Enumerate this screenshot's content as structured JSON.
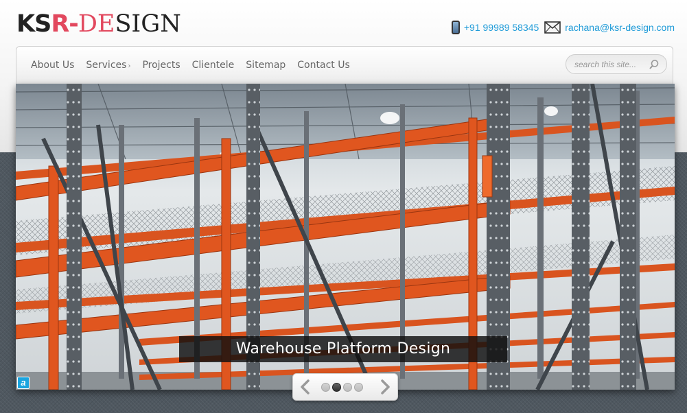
{
  "logo": {
    "part1": "KS",
    "part2": "R-",
    "part3": "DE",
    "part4": "SIGN"
  },
  "contact": {
    "phone": "+91 99989 58345",
    "email": "rachana@ksr-design.com",
    "phone_icon": "mobile-phone-icon",
    "email_icon": "envelope-icon"
  },
  "nav": {
    "items": [
      {
        "label": "About Us"
      },
      {
        "label": "Services",
        "submenu_arrow": "›"
      },
      {
        "label": "Projects"
      },
      {
        "label": "Clientele"
      },
      {
        "label": "Sitemap"
      },
      {
        "label": "Contact Us"
      }
    ]
  },
  "search": {
    "placeholder": "search this site..."
  },
  "slider": {
    "caption": "Warehouse Platform Design",
    "total_slides": 4,
    "active_slide": 2,
    "corner_badge": "a"
  },
  "colors": {
    "accent": "#e2485e",
    "link": "#1f9bd8",
    "rack_orange": "#e0561f",
    "steel": "#5b6168",
    "page_dark": "#4f5860"
  }
}
